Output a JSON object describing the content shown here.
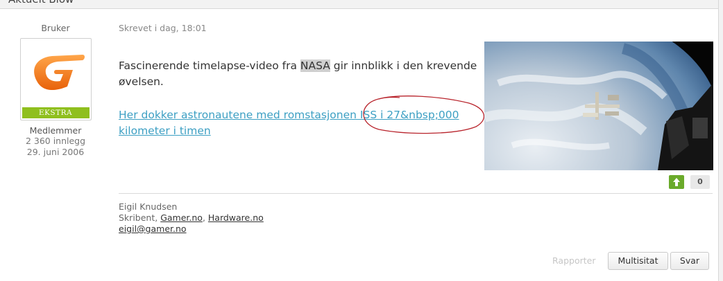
{
  "thread_header": {
    "title": "Aktuelt Blow"
  },
  "author": {
    "role": "Bruker",
    "badge": "EKSTRA",
    "group": "Medlemmer",
    "posts": "2 360 innlegg",
    "joined": "29. juni 2006"
  },
  "post": {
    "meta": "Skrevet i dag, 18:01",
    "text_before": "Fascinerende timelapse-video fra ",
    "text_highlight": "NASA",
    "text_after": " gir innblikk i den krevende øvelsen.",
    "link_text": "Her dokker astronautene med romstasjonen ISS i 27&nbsp;000 kilometer i timen",
    "vote_count": "0"
  },
  "signature": {
    "name": "Eigil Knudsen",
    "prefix": "Skribent, ",
    "link1": "Gamer.no",
    "sep": ", ",
    "link2": "Hardware.no",
    "email": "eigil@gamer.no"
  },
  "actions": {
    "report": "Rapporter",
    "multiquote": "Multisitat",
    "reply": "Svar"
  },
  "colors": {
    "badge": "#8fbf1e",
    "link": "#3c9fc3",
    "vote_up": "#6aaa2a",
    "avatar_logo": "#f07a1a"
  },
  "icons": {
    "vote_up": "arrow-up-icon",
    "avatar": "gamer-logo-icon"
  }
}
